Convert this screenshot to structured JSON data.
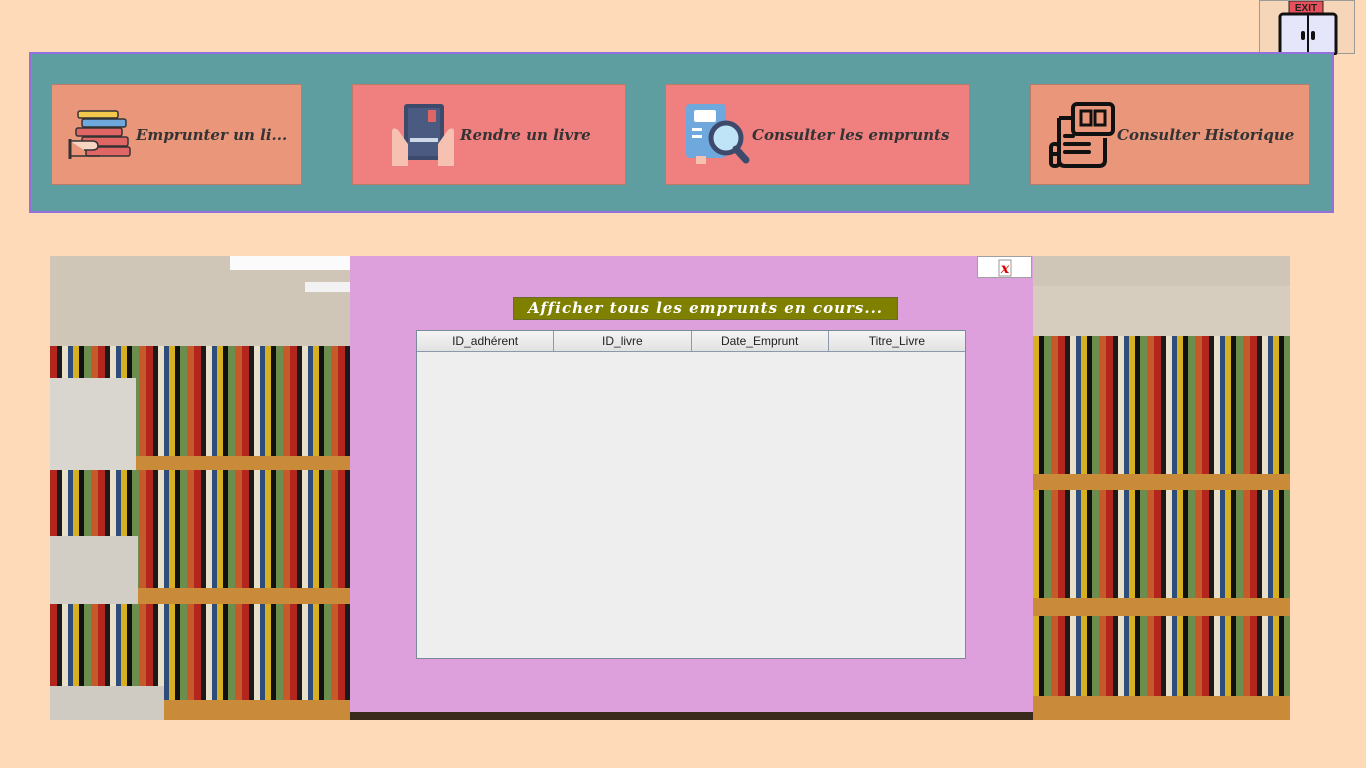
{
  "exit": {
    "sign": "EXIT"
  },
  "nav": {
    "borrow": "Emprunter un li...",
    "return": "Rendre un livre",
    "consult_loans": "Consulter les emprunts",
    "consult_history": "Consulter Historique"
  },
  "panel": {
    "close_label": "x",
    "title": "Afficher tous les emprunts en cours...",
    "table": {
      "columns": [
        "ID_adhérent",
        "ID_livre",
        "Date_Emprunt",
        "Titre_Livre"
      ],
      "rows": []
    }
  },
  "colors": {
    "background": "#ffdab9",
    "toolbar": "#5f9ea0",
    "toolbar_border": "#9370db",
    "button_salmon": "#e9967a",
    "button_coral": "#f08080",
    "panel": "#dda0dd",
    "title_bg": "#808000"
  }
}
